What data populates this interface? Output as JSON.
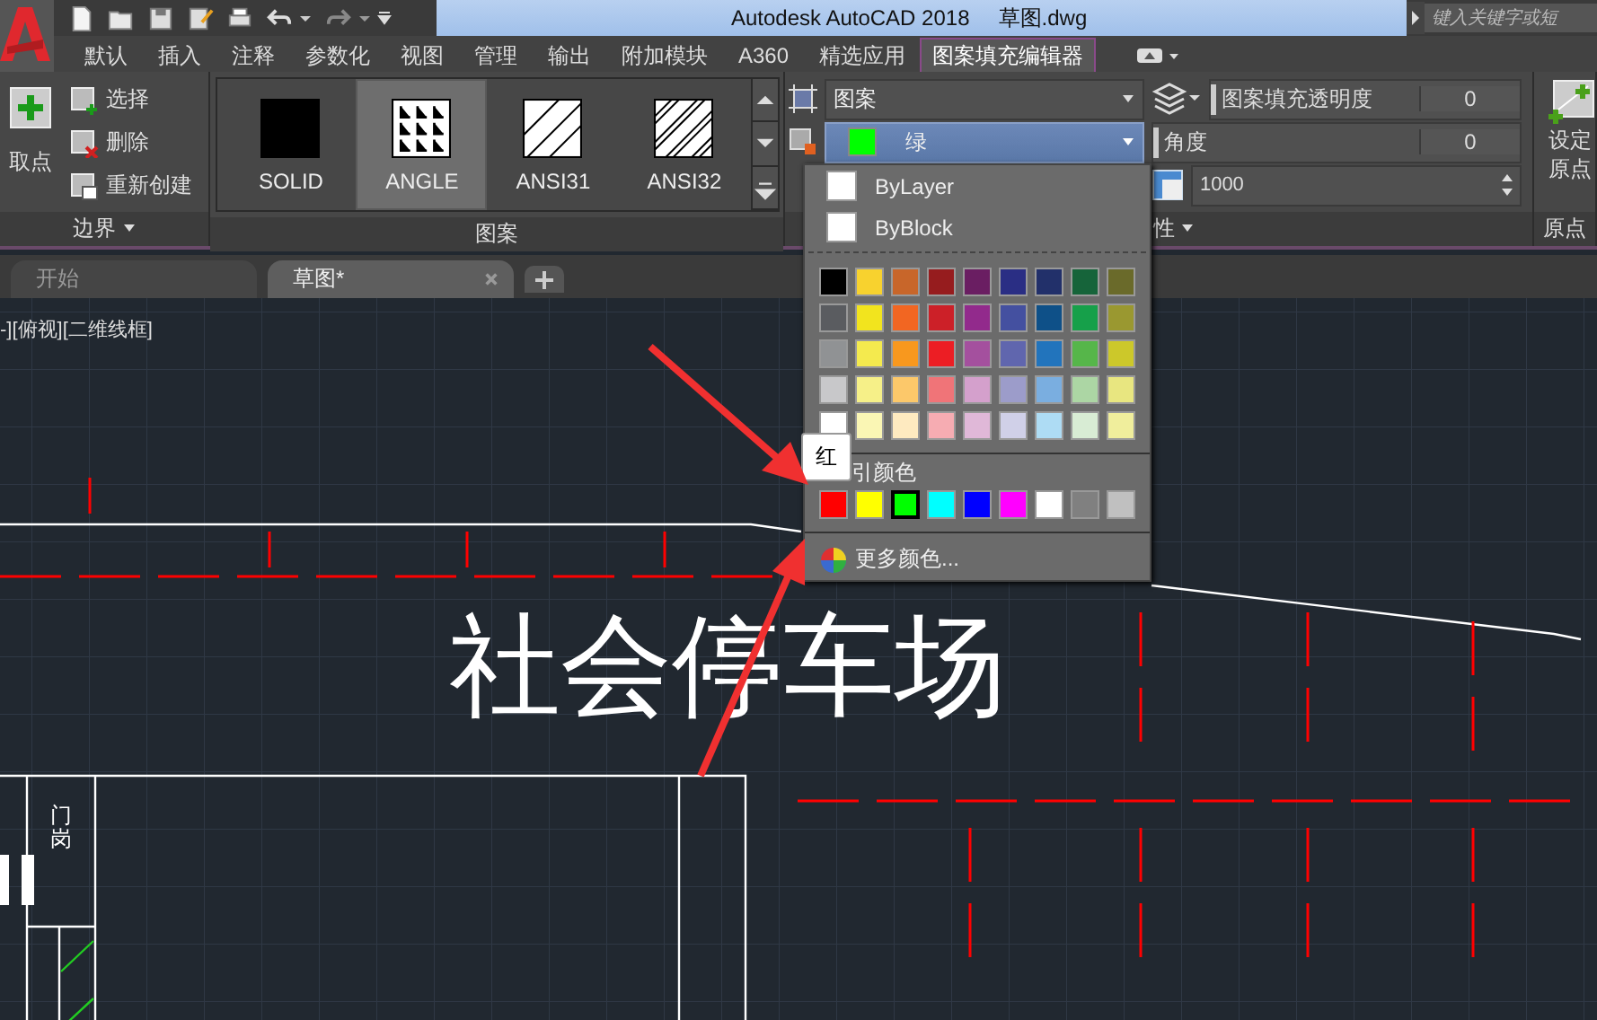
{
  "title_bar": {
    "title": "Autodesk AutoCAD 2018",
    "file": "草图.dwg",
    "search": {
      "placeholder": "键入关键字或短"
    }
  },
  "ribbon_tabs": [
    {
      "label": "默认",
      "selected": false
    },
    {
      "label": "插入",
      "selected": false
    },
    {
      "label": "注释",
      "selected": false
    },
    {
      "label": "参数化",
      "selected": false
    },
    {
      "label": "视图",
      "selected": false
    },
    {
      "label": "管理",
      "selected": false
    },
    {
      "label": "输出",
      "selected": false
    },
    {
      "label": "附加模块",
      "selected": false
    },
    {
      "label": "A360",
      "selected": false
    },
    {
      "label": "精选应用",
      "selected": false
    },
    {
      "label": "图案填充编辑器",
      "selected": true
    }
  ],
  "ribbon": {
    "boundaries": {
      "pick_button": "取点",
      "actions": [
        {
          "label": "选择",
          "kind": "select"
        },
        {
          "label": "删除",
          "kind": "remove"
        },
        {
          "label": "重新创建",
          "kind": "recreate"
        }
      ],
      "title": "边界"
    },
    "patterns": {
      "items": [
        {
          "label": "SOLID",
          "kind": "solid",
          "selected": false
        },
        {
          "label": "ANGLE",
          "kind": "angle",
          "selected": true
        },
        {
          "label": "ANSI31",
          "kind": "ansi31",
          "selected": false
        },
        {
          "label": "ANSI32",
          "kind": "ansi32",
          "selected": false
        }
      ],
      "title": "图案"
    },
    "properties": {
      "type_dropdown": "图案",
      "color_dropdown": {
        "label": "绿",
        "color": "#00ff00"
      },
      "scale": "1000",
      "transparency": {
        "label": "图案填充透明度",
        "value": "0"
      },
      "angle": {
        "label": "角度",
        "value": "0"
      },
      "title": "性"
    },
    "origin": {
      "button_lines": [
        "设定",
        "原点"
      ],
      "title": "原点"
    }
  },
  "doc_tabs": [
    {
      "label": "开始",
      "selected": false,
      "closable": false
    },
    {
      "label": "草图*",
      "selected": true,
      "closable": true
    }
  ],
  "viewport_label": "-][俯视][二维线框]",
  "drawing": {
    "title": "社会停车场",
    "gate_label": "门岗"
  },
  "color_menu": {
    "items": [
      "ByLayer",
      "ByBlock"
    ],
    "palette": [
      {
        "color": "#000000"
      },
      {
        "color": "#f8d22e"
      },
      {
        "color": "#c8662a"
      },
      {
        "color": "#961c1e"
      },
      {
        "color": "#6a1e62"
      },
      {
        "color": "#2a2e84"
      },
      {
        "color": "#22306a"
      },
      {
        "color": "#16643a"
      },
      {
        "color": "#6a6a2a"
      },
      {
        "color": "#5a5c60"
      },
      {
        "color": "#f2e41e"
      },
      {
        "color": "#f26622"
      },
      {
        "color": "#cc2028"
      },
      {
        "color": "#922a8c"
      },
      {
        "color": "#4450a0"
      },
      {
        "color": "#0e5088"
      },
      {
        "color": "#16a04a"
      },
      {
        "color": "#9a9830"
      },
      {
        "color": "#909294"
      },
      {
        "color": "#f4ea4e"
      },
      {
        "color": "#f8981e"
      },
      {
        "color": "#ec1e24"
      },
      {
        "color": "#a4509e"
      },
      {
        "color": "#6066ae"
      },
      {
        "color": "#2274bc"
      },
      {
        "color": "#56b64a"
      },
      {
        "color": "#ccc82a"
      },
      {
        "color": "#c8c8ca"
      },
      {
        "color": "#f6f088"
      },
      {
        "color": "#fcc86a"
      },
      {
        "color": "#f07478"
      },
      {
        "color": "#d4a0cc"
      },
      {
        "color": "#9c9cca"
      },
      {
        "color": "#7aaee0"
      },
      {
        "color": "#acd6a4"
      },
      {
        "color": "#e8e680"
      },
      {
        "color": "#ffffff"
      },
      {
        "color": "#faf6b4"
      },
      {
        "color": "#feeac0"
      },
      {
        "color": "#f6acb2"
      },
      {
        "color": "#e0b8d8"
      },
      {
        "color": "#d0d0e8"
      },
      {
        "color": "#aedcf4"
      },
      {
        "color": "#d8ecd4"
      },
      {
        "color": "#f0ee9c"
      }
    ],
    "index_label": "引颜色",
    "standard_colors": [
      {
        "color": "#ff0000",
        "selected": false
      },
      {
        "color": "#ffff00",
        "selected": false
      },
      {
        "color": "#00ff00",
        "selected": true
      },
      {
        "color": "#00ffff",
        "selected": false
      },
      {
        "color": "#0000ff",
        "selected": false
      },
      {
        "color": "#ff00ff",
        "selected": false
      },
      {
        "color": "#ffffff",
        "selected": false
      },
      {
        "color": "#808080",
        "selected": false
      },
      {
        "color": "#c0c0c0",
        "selected": false
      }
    ],
    "more": "更多颜色...",
    "tooltip": "红"
  }
}
